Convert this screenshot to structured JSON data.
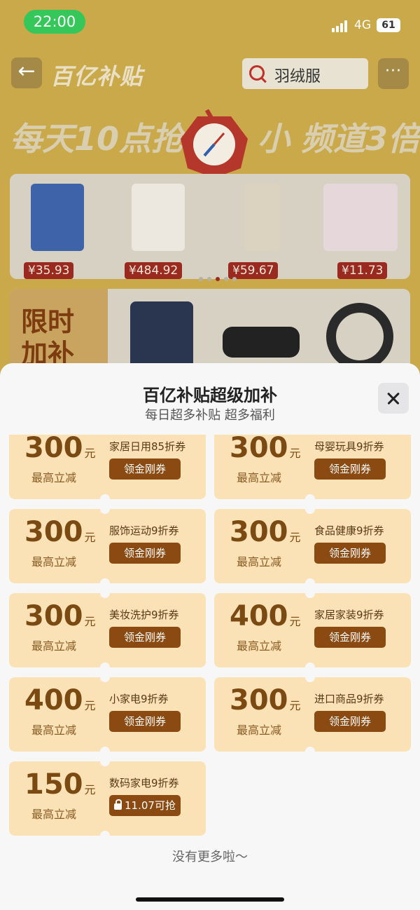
{
  "status": {
    "time": "22:00",
    "network": "4G",
    "battery": "61"
  },
  "nav": {
    "title": "百亿补贴",
    "search_text": "羽绒服",
    "more": "···",
    "back": "←"
  },
  "banner": {
    "left": "每天10点抢",
    "right": "小 频道3倍"
  },
  "products": [
    {
      "price": "¥35.93"
    },
    {
      "price": "¥484.92"
    },
    {
      "price": "¥59.67"
    },
    {
      "price": "¥11.73"
    }
  ],
  "flash": {
    "line1": "限时",
    "line2": "加补"
  },
  "modal": {
    "title": "百亿补贴超级加补",
    "subtitle": "每日超多补贴 超多福利",
    "coupons": [
      {
        "amount": "300",
        "unit": "元",
        "desc": "最高立减",
        "name": "家居日用85折券",
        "button": "领金刚券"
      },
      {
        "amount": "300",
        "unit": "元",
        "desc": "最高立减",
        "name": "母婴玩具9折券",
        "button": "领金刚券"
      },
      {
        "amount": "300",
        "unit": "元",
        "desc": "最高立减",
        "name": "服饰运动9折券",
        "button": "领金刚券"
      },
      {
        "amount": "300",
        "unit": "元",
        "desc": "最高立减",
        "name": "食品健康9折券",
        "button": "领金刚券"
      },
      {
        "amount": "300",
        "unit": "元",
        "desc": "最高立减",
        "name": "美妆洗护9折券",
        "button": "领金刚券"
      },
      {
        "amount": "400",
        "unit": "元",
        "desc": "最高立减",
        "name": "家居家装9折券",
        "button": "领金刚券"
      },
      {
        "amount": "400",
        "unit": "元",
        "desc": "最高立减",
        "name": "小家电9折券",
        "button": "领金刚券"
      },
      {
        "amount": "300",
        "unit": "元",
        "desc": "最高立减",
        "name": "进口商品9折券",
        "button": "领金刚券"
      },
      {
        "amount": "150",
        "unit": "元",
        "desc": "最高立减",
        "name": "数码家电9折券",
        "button": "11.07可抢"
      }
    ],
    "footer": "没有更多啦～"
  }
}
